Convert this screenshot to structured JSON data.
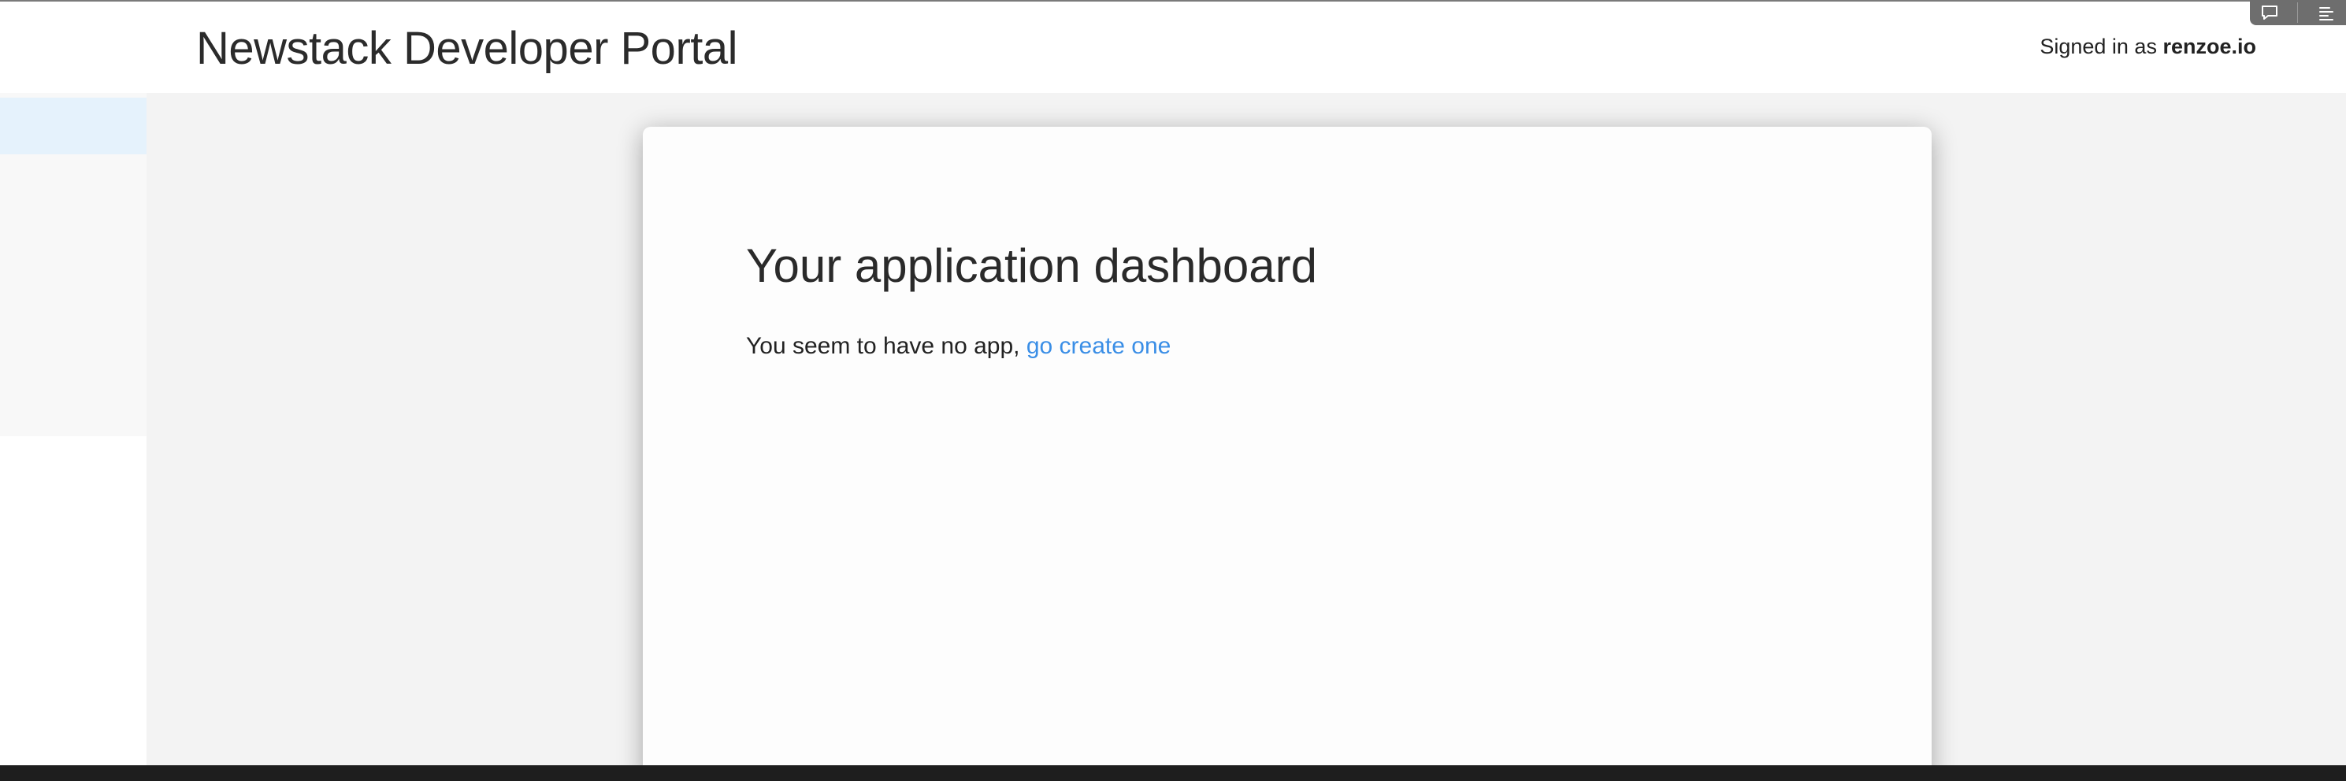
{
  "header": {
    "title": "Newstack Developer Portal",
    "signed_in_prefix": "Signed in as",
    "signed_in_user": "renzoe.io"
  },
  "corner_tools": {
    "icons": [
      "speech-bubble-icon",
      "align-left-icon"
    ]
  },
  "main": {
    "heading": "Your application dashboard",
    "message": "You seem to have no app,",
    "link_text": "go create one"
  },
  "colors": {
    "link": "#3a8ee6",
    "sidebar_active": "#e5f2fc",
    "main_background": "#f3f3f3",
    "card_background": "#fdfdfd"
  }
}
